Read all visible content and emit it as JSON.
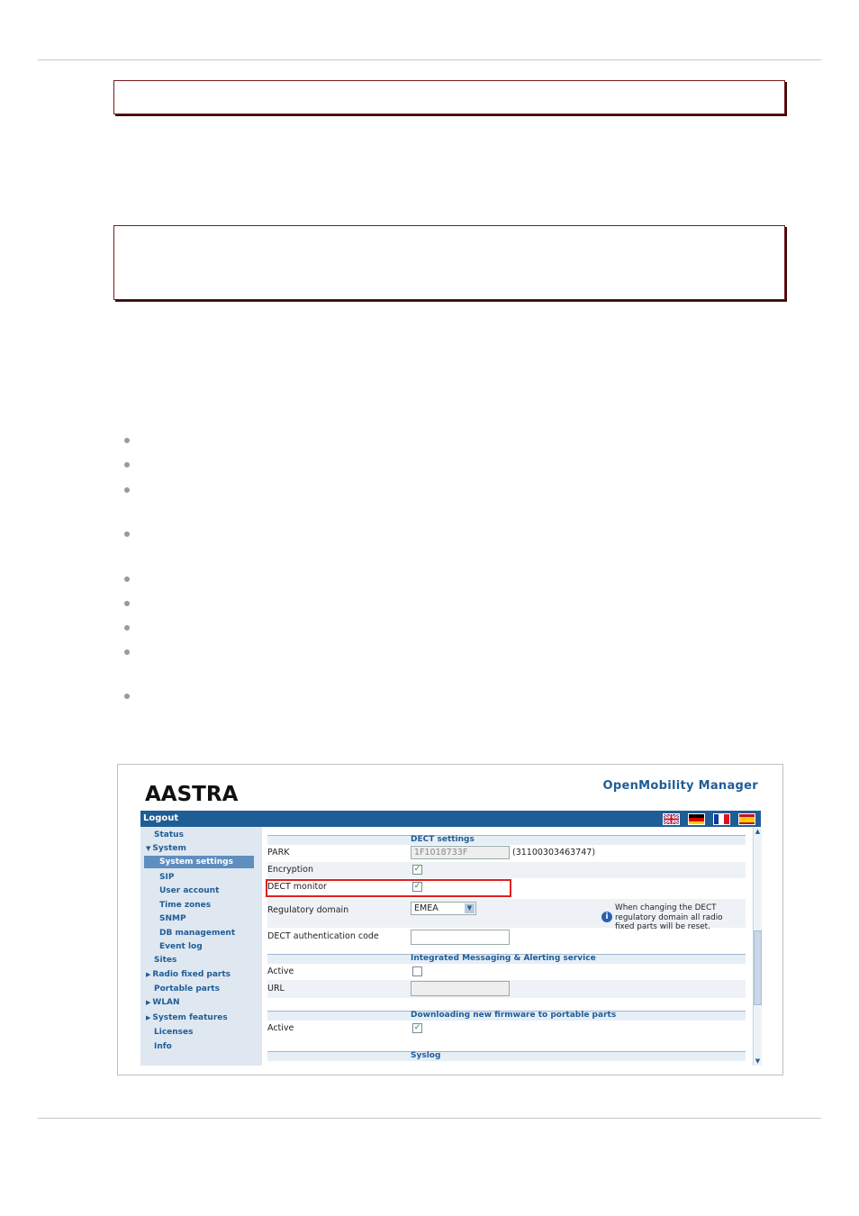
{
  "screenshot": {
    "app_title": "OpenMobility Manager",
    "logo_text": "AASTRA",
    "logout_label": "Logout",
    "flags": [
      "english-flag",
      "german-flag",
      "french-flag",
      "spanish-flag"
    ],
    "nav": {
      "status": "Status",
      "system": "System",
      "system_settings": "System settings",
      "sip": "SIP",
      "user_account": "User account",
      "time_zones": "Time zones",
      "snmp": "SNMP",
      "db_management": "DB management",
      "event_log": "Event log",
      "sites": "Sites",
      "radio_fixed_parts": "Radio fixed parts",
      "portable_parts": "Portable parts",
      "wlan": "WLAN",
      "system_features": "System features",
      "licenses": "Licenses",
      "info": "Info"
    },
    "dect": {
      "section_title": "DECT settings",
      "park_label": "PARK",
      "park_value": "1F1018733F",
      "park_extra": "(31100303463747)",
      "encryption_label": "Encryption",
      "encryption_checked": true,
      "dect_monitor_label": "DECT monitor",
      "dect_monitor_checked": true,
      "regulatory_label": "Regulatory domain",
      "regulatory_value": "EMEA",
      "regulatory_note": "When changing the DECT regulatory domain all radio fixed parts will be reset.",
      "auth_label": "DECT authentication code",
      "auth_value": ""
    },
    "messaging": {
      "section_title": "Integrated Messaging & Alerting service",
      "active_label": "Active",
      "active_checked": false,
      "url_label": "URL",
      "url_value": ""
    },
    "firmware": {
      "section_title": "Downloading new firmware to portable parts",
      "active_label": "Active",
      "active_checked": true
    },
    "syslog": {
      "section_title": "Syslog"
    },
    "colors": {
      "brand": "#1f5d96",
      "highlight": "#e02020",
      "check": "#1a8a1a"
    }
  }
}
